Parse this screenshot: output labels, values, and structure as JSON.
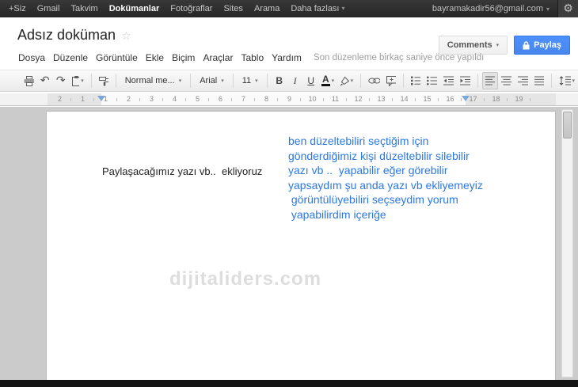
{
  "icons": {
    "undo": "↶",
    "redo": "↷",
    "dropdown": "▾",
    "star": "☆",
    "gear": "⚙",
    "bold": "B",
    "italic": "I",
    "underline": "U",
    "text_color": "A"
  },
  "topbar": {
    "items": [
      "+Siz",
      "Gmail",
      "Takvim",
      "Dokümanlar",
      "Fotoğraflar",
      "Sites",
      "Arama"
    ],
    "more_label": "Daha fazlası",
    "active_item": "Dokümanlar",
    "account_email": "bayramakadir56@gmail.com"
  },
  "header": {
    "doc_title": "Adsız doküman",
    "comments_label": "Comments",
    "share_label": "Paylaş"
  },
  "menubar": {
    "items": [
      "Dosya",
      "Düzenle",
      "Görüntüle",
      "Ekle",
      "Biçim",
      "Araçlar",
      "Tablo",
      "Yardım"
    ],
    "status": "Son düzenleme birkaç saniye önce yapıldı"
  },
  "toolbar": {
    "style": "Normal me...",
    "font": "Arial",
    "size": "11"
  },
  "ruler": {
    "numbers": [
      "2",
      "1",
      "1",
      "2",
      "3",
      "4",
      "5",
      "6",
      "7",
      "8",
      "9",
      "10",
      "11",
      "12",
      "13",
      "14",
      "15",
      "16",
      "17",
      "18",
      "19"
    ]
  },
  "document": {
    "paragraph": "Paylaşacağımız yazı vb..  ekliyoruz",
    "blue_lines": [
      "ben düzeltebiliri seçtiğim için",
      "gönderdiğimiz kişi düzeltebilir silebilir",
      "yazı vb ..  yapabilir eğer görebilir",
      "yapsaydım şu anda yazı vb ekliyemeyiz",
      " görüntülüyebiliri seçseydim yorum",
      " yapabilirdim içeriğe"
    ],
    "watermark": "dijitaliders.com"
  },
  "colors": {
    "share_button_blue": "#4d90fe",
    "doc_text_blue": "#2b78e4",
    "topbar_bg": "#2b2b2b",
    "canvas_gray": "#cbcbcb"
  }
}
